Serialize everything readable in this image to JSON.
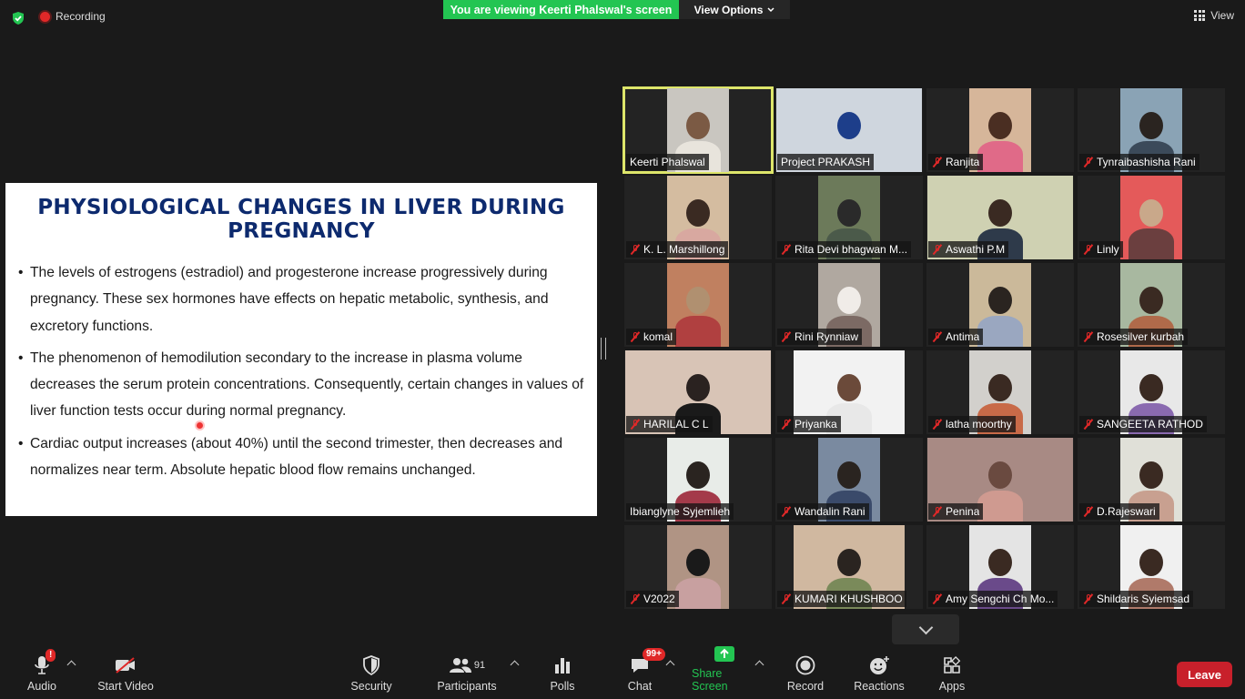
{
  "topbar": {
    "recording_label": "Recording",
    "viewing_banner": "You are viewing Keerti Phalswal's screen",
    "view_options_label": "View Options",
    "view_label": "View"
  },
  "slide": {
    "title_line1": "PHYSIOLOGICAL CHANGES IN LIVER DURING",
    "title_line2": "PREGNANCY",
    "bullets": [
      "The levels of estrogens (estradiol) and progesterone increase progressively during pregnancy. These sex hormones have effects on hepatic metabolic, synthesis, and excretory functions.",
      "The phenomenon of hemodilution secondary to the increase in plasma volume decreases the serum protein concentrations. Consequently, certain changes in values of liver function tests occur during normal pregnancy.",
      "Cardiac output increases (about 40%) until the second trimester, then decreases and normalizes near term. Absolute hepatic blood flow remains unchanged."
    ]
  },
  "participants": [
    {
      "name": "Keerti Phalswal",
      "muted": false,
      "active": true
    },
    {
      "name": "Project PRAKASH",
      "muted": false,
      "active": false
    },
    {
      "name": "Ranjita",
      "muted": true,
      "active": false
    },
    {
      "name": "Tynraibashisha Rani",
      "muted": true,
      "active": false
    },
    {
      "name": "K. L. Marshillong",
      "muted": true,
      "active": false
    },
    {
      "name": "Rita Devi bhagwan M...",
      "muted": true,
      "active": false
    },
    {
      "name": "Aswathi P.M",
      "muted": true,
      "active": false
    },
    {
      "name": "Linly",
      "muted": true,
      "active": false
    },
    {
      "name": "komal",
      "muted": true,
      "active": false
    },
    {
      "name": "Rini Rynniaw",
      "muted": true,
      "active": false
    },
    {
      "name": "Antima",
      "muted": true,
      "active": false
    },
    {
      "name": "Rosesilver kurbah",
      "muted": true,
      "active": false
    },
    {
      "name": "HARILAL C L",
      "muted": true,
      "active": false
    },
    {
      "name": "Priyanka",
      "muted": true,
      "active": false
    },
    {
      "name": "latha moorthy",
      "muted": true,
      "active": false
    },
    {
      "name": "SANGEETA RATHOD",
      "muted": true,
      "active": false
    },
    {
      "name": "Ibianglyne Syjemlieh",
      "muted": false,
      "active": false
    },
    {
      "name": "Wandalin Rani",
      "muted": true,
      "active": false
    },
    {
      "name": "Penina",
      "muted": true,
      "active": false
    },
    {
      "name": "D.Rajeswari",
      "muted": true,
      "active": false
    },
    {
      "name": "V2022",
      "muted": true,
      "active": false
    },
    {
      "name": "KUMARI KHUSHBOO",
      "muted": true,
      "active": false
    },
    {
      "name": "Amy Sengchi Ch Mo...",
      "muted": true,
      "active": false
    },
    {
      "name": "Shildaris Syiemsad",
      "muted": true,
      "active": false
    }
  ],
  "toolbar": {
    "audio": "Audio",
    "audio_badge": "!",
    "start_video": "Start Video",
    "security": "Security",
    "participants": "Participants",
    "participants_count": "91",
    "polls": "Polls",
    "chat": "Chat",
    "chat_badge": "99+",
    "share_screen": "Share Screen",
    "record": "Record",
    "reactions": "Reactions",
    "apps": "Apps",
    "leave": "Leave"
  },
  "colors": {
    "accent_green": "#23c552",
    "leave_red": "#c8202b",
    "slide_title": "#0d2a6e",
    "active_speaker": "#dde56a"
  }
}
